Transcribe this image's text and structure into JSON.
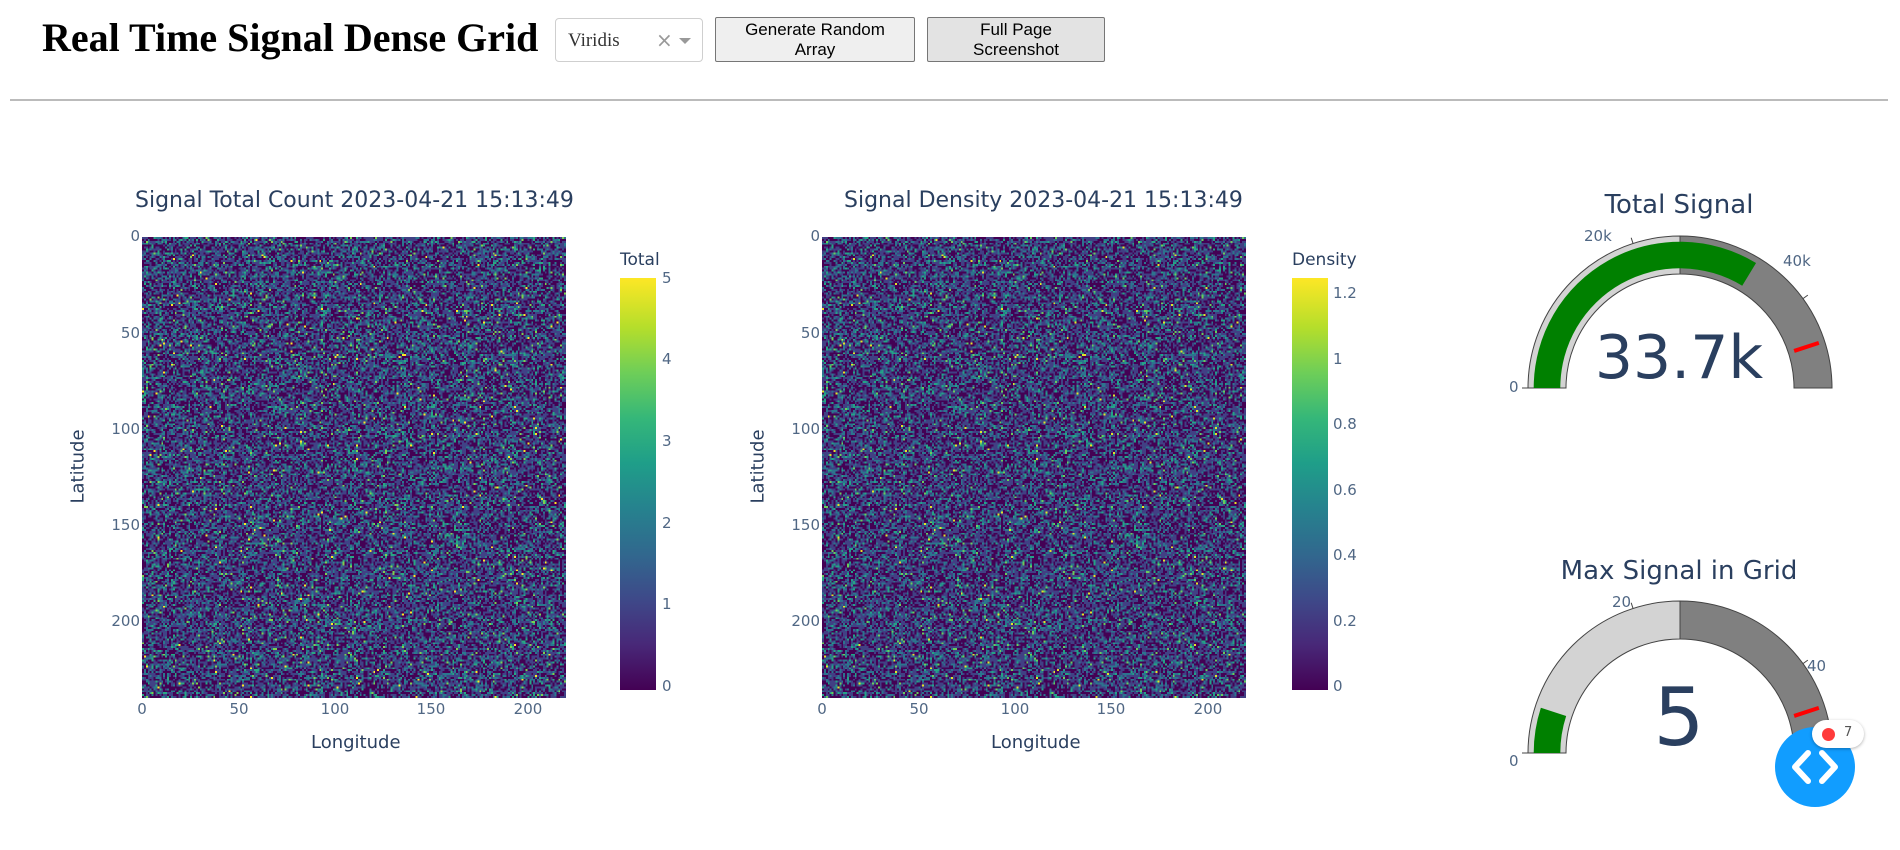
{
  "header": {
    "title": "Real Time Signal Dense Grid",
    "colorscale_select": {
      "value": "Viridis",
      "clear_glyph": "×"
    },
    "generate_button": "Generate Random Array",
    "screenshot_button": "Full Page Screenshot"
  },
  "colors": {
    "viridis": [
      "#440154",
      "#482878",
      "#3e4989",
      "#31688e",
      "#26828e",
      "#1f9e89",
      "#35b779",
      "#6ece58",
      "#b5de2b",
      "#fde725"
    ],
    "gauge_bar": "#008000",
    "gauge_step_light": "#d3d3d3",
    "gauge_step_dark": "#808080",
    "gauge_threshold": "#ff0000",
    "fab_blue": "#119dff"
  },
  "heatmaps": [
    {
      "title": "Signal Total Count 2023-04-21 15:13:49",
      "xlabel": "Longitude",
      "ylabel": "Latitude",
      "x_ticks": [
        "0",
        "50",
        "100",
        "150",
        "200"
      ],
      "y_ticks": [
        "0",
        "50",
        "100",
        "150",
        "200"
      ],
      "colorbar_title": "Total",
      "colorbar_ticks": [
        "5",
        "4",
        "3",
        "2",
        "1",
        "0"
      ]
    },
    {
      "title": "Signal Density 2023-04-21 15:13:49",
      "xlabel": "Longitude",
      "ylabel": "Latitude",
      "x_ticks": [
        "0",
        "50",
        "100",
        "150",
        "200"
      ],
      "y_ticks": [
        "0",
        "50",
        "100",
        "150",
        "200"
      ],
      "colorbar_title": "Density",
      "colorbar_ticks": [
        "1.2",
        "1",
        "0.8",
        "0.6",
        "0.4",
        "0.2",
        "0"
      ]
    }
  ],
  "gauges": [
    {
      "title": "Total Signal",
      "value_text": "33.7k",
      "tick_labels": [
        "0",
        "20k",
        "40k"
      ]
    },
    {
      "title": "Max Signal in Grid",
      "value_text": "5",
      "tick_labels": [
        "0",
        "20",
        "40"
      ]
    }
  ],
  "chart_data": [
    {
      "type": "heatmap",
      "title": "Signal Total Count 2023-04-21 15:13:49",
      "xlabel": "Longitude",
      "ylabel": "Latitude",
      "xlim": [
        0,
        220
      ],
      "ylim": [
        240,
        0
      ],
      "zlim": [
        0,
        5
      ],
      "colorscale": "Viridis",
      "colorbar_title": "Total"
    },
    {
      "type": "heatmap",
      "title": "Signal Density 2023-04-21 15:13:49",
      "xlabel": "Longitude",
      "ylabel": "Latitude",
      "xlim": [
        0,
        220
      ],
      "ylim": [
        240,
        0
      ],
      "zlim": [
        0,
        1.25
      ],
      "colorscale": "Viridis",
      "colorbar_title": "Density"
    },
    {
      "type": "gauge",
      "title": "Total Signal",
      "value": 33700,
      "range": [
        0,
        50000
      ],
      "steps": [
        [
          0,
          25000
        ],
        [
          25000,
          50000
        ]
      ],
      "threshold": 45000
    },
    {
      "type": "gauge",
      "title": "Max Signal in Grid",
      "value": 5,
      "range": [
        0,
        50
      ],
      "steps": [
        [
          0,
          25
        ],
        [
          25,
          50
        ]
      ],
      "threshold": 45
    }
  ],
  "devtools": {
    "error_count": "7"
  }
}
